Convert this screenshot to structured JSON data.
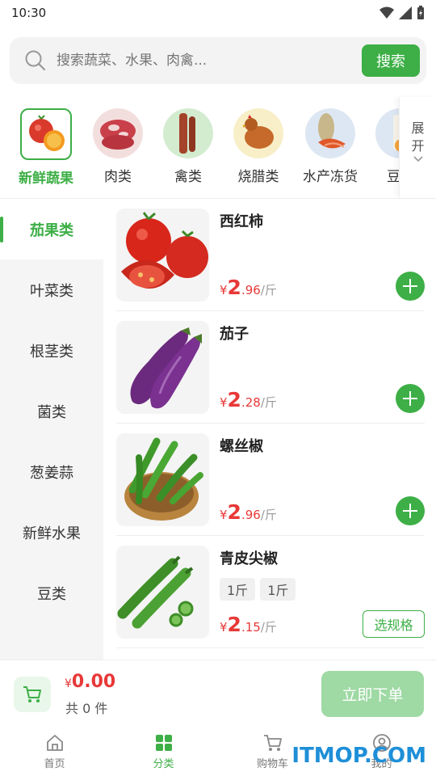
{
  "status_bar": {
    "time": "10:30"
  },
  "search": {
    "placeholder": "搜索蔬菜、水果、肉禽...",
    "button_label": "搜索"
  },
  "categories": [
    {
      "label": "新鲜蔬果",
      "icon": "vegetables-fruit-icon",
      "active": true
    },
    {
      "label": "肉类",
      "icon": "meat-icon"
    },
    {
      "label": "禽类",
      "icon": "poultry-icon"
    },
    {
      "label": "烧腊类",
      "icon": "roast-meat-icon"
    },
    {
      "label": "水产冻货",
      "icon": "seafood-icon"
    },
    {
      "label": "豆品",
      "icon": "bean-product-icon"
    }
  ],
  "expand": {
    "label_line1": "展",
    "label_line2": "开"
  },
  "side_nav": [
    {
      "label": "茄果类",
      "active": true
    },
    {
      "label": "叶菜类"
    },
    {
      "label": "根茎类"
    },
    {
      "label": "菌类"
    },
    {
      "label": "葱姜蒜"
    },
    {
      "label": "新鲜水果"
    },
    {
      "label": "豆类"
    }
  ],
  "products": [
    {
      "name": "西红柿",
      "currency": "¥",
      "price_int": "2",
      "price_dec": ".96",
      "unit": "/斤",
      "action": "add"
    },
    {
      "name": "茄子",
      "currency": "¥",
      "price_int": "2",
      "price_dec": ".28",
      "unit": "/斤",
      "action": "add"
    },
    {
      "name": "螺丝椒",
      "currency": "¥",
      "price_int": "2",
      "price_dec": ".96",
      "unit": "/斤",
      "action": "add"
    },
    {
      "name": "青皮尖椒",
      "currency": "¥",
      "price_int": "2",
      "price_dec": ".15",
      "unit": "/斤",
      "action": "spec",
      "specs": [
        "1斤",
        "1斤"
      ],
      "spec_label": "选规格"
    }
  ],
  "cart": {
    "currency": "¥",
    "total": "0.00",
    "count_text": "共 0 件",
    "order_label": "立即下单"
  },
  "tabs": [
    {
      "label": "首页",
      "icon": "home-icon"
    },
    {
      "label": "分类",
      "icon": "category-grid-icon",
      "active": true
    },
    {
      "label": "购物车",
      "icon": "cart-icon"
    },
    {
      "label": "我的",
      "icon": "profile-icon"
    }
  ],
  "watermark": "ITMOP.COM",
  "colors": {
    "accent": "#3daf46",
    "price": "#e83838",
    "accent_light": "#9fd9a4"
  }
}
